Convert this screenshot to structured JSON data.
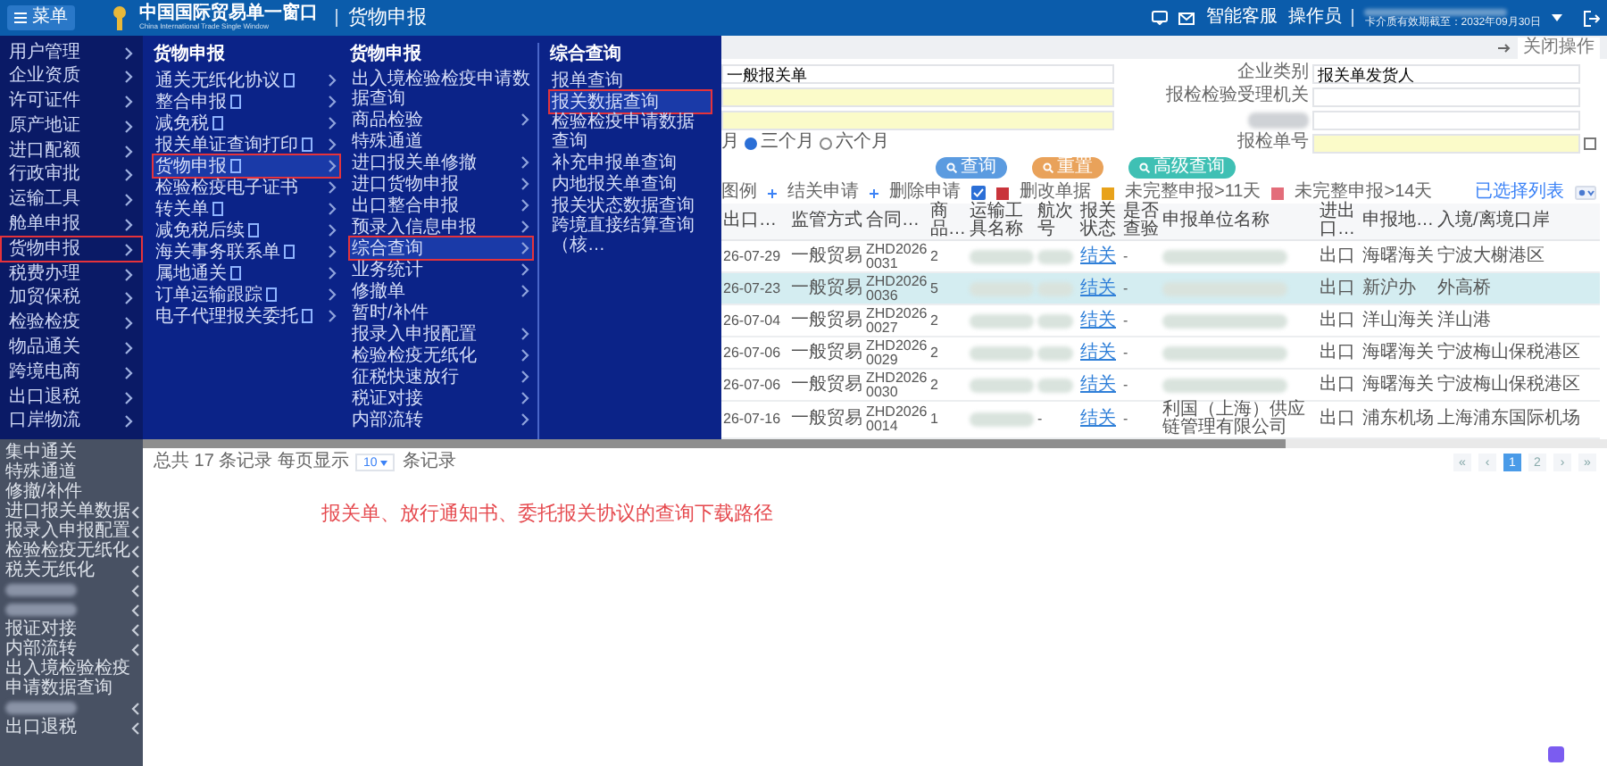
{
  "header": {
    "menu_button": "菜单",
    "logo_title": "中国国际贸易单一窗口",
    "logo_subtitle": "China International Trade Single Window",
    "page_title": "货物申报",
    "service": "智能客服",
    "operator": "操作员",
    "expiry": "卡介质有效期截至：2032年09月30日"
  },
  "sidebar": {
    "items": [
      {
        "label": "用户管理",
        "selected": false
      },
      {
        "label": "企业资质",
        "selected": false
      },
      {
        "label": "许可证件",
        "selected": false
      },
      {
        "label": "原产地证",
        "selected": false
      },
      {
        "label": "进口配额",
        "selected": false
      },
      {
        "label": "行政审批",
        "selected": false
      },
      {
        "label": "运输工具",
        "selected": false
      },
      {
        "label": "舱单申报",
        "selected": false
      },
      {
        "label": "货物申报",
        "selected": true
      },
      {
        "label": "税费办理",
        "selected": false
      },
      {
        "label": "加贸保税",
        "selected": false
      },
      {
        "label": "检验检疫",
        "selected": false
      },
      {
        "label": "物品通关",
        "selected": false
      },
      {
        "label": "跨境电商",
        "selected": false
      },
      {
        "label": "出口退税",
        "selected": false
      },
      {
        "label": "口岸物流",
        "selected": false
      }
    ],
    "sub_items": [
      {
        "kind": "text",
        "label": "集中通关",
        "expandable": false
      },
      {
        "kind": "text",
        "label": "特殊通道",
        "expandable": false
      },
      {
        "kind": "text",
        "label": "修撤/补件",
        "expandable": false
      },
      {
        "kind": "text",
        "label": "进口报关单数据",
        "expandable": true
      },
      {
        "kind": "text",
        "label": "报录入申报配置",
        "expandable": true
      },
      {
        "kind": "text",
        "label": "检验检疫无纸化",
        "expandable": true
      },
      {
        "kind": "text",
        "label": "税关无纸化",
        "expandable": true
      },
      {
        "kind": "redacted",
        "expandable": true
      },
      {
        "kind": "redacted",
        "expandable": true
      },
      {
        "kind": "text",
        "label": "报证对接",
        "expandable": true
      },
      {
        "kind": "text",
        "label": "内部流转",
        "expandable": true
      },
      {
        "kind": "text",
        "label": "出入境检验检疫申请数据查询",
        "expandable": false
      },
      {
        "kind": "redacted",
        "expandable": true
      },
      {
        "kind": "text",
        "label": "出口退税",
        "expandable": true
      }
    ]
  },
  "menu": {
    "columns": [
      {
        "heading": "货物申报",
        "items": [
          {
            "label": "通关无纸化协议",
            "doc": true,
            "arrow": true,
            "selected": false
          },
          {
            "label": "整合申报",
            "doc": true,
            "arrow": true,
            "selected": false
          },
          {
            "label": "减免税",
            "doc": true,
            "arrow": true,
            "selected": false
          },
          {
            "label": "报关单证查询打印",
            "doc": true,
            "arrow": true,
            "selected": false
          },
          {
            "label": "货物申报",
            "doc": true,
            "arrow": true,
            "selected": true
          },
          {
            "label": "检验检疫电子证书",
            "doc": false,
            "arrow": true,
            "selected": false
          },
          {
            "label": "转关单",
            "doc": true,
            "arrow": true,
            "selected": false
          },
          {
            "label": "减免税后续",
            "doc": true,
            "arrow": true,
            "selected": false
          },
          {
            "label": "海关事务联系单",
            "doc": true,
            "arrow": true,
            "selected": false
          },
          {
            "label": "属地通关",
            "doc": true,
            "arrow": true,
            "selected": false
          },
          {
            "label": "订单运输跟踪",
            "doc": true,
            "arrow": true,
            "selected": false
          },
          {
            "label": "电子代理报关委托",
            "doc": true,
            "arrow": true,
            "selected": false
          }
        ]
      },
      {
        "heading": "货物申报",
        "items": [
          {
            "label": "出入境检验检疫申请数据查询",
            "doc": false,
            "arrow": false,
            "selected": false
          },
          {
            "label": "商品检验",
            "doc": false,
            "arrow": true,
            "selected": false
          },
          {
            "label": "特殊通道",
            "doc": false,
            "arrow": false,
            "selected": false
          },
          {
            "label": "进口报关单修撤",
            "doc": false,
            "arrow": true,
            "selected": false
          },
          {
            "label": "进口货物申报",
            "doc": false,
            "arrow": true,
            "selected": false
          },
          {
            "label": "出口整合申报",
            "doc": false,
            "arrow": true,
            "selected": false
          },
          {
            "label": "预录入信息申报",
            "doc": false,
            "arrow": true,
            "selected": false
          },
          {
            "label": "综合查询",
            "doc": false,
            "arrow": true,
            "selected": true
          },
          {
            "label": "业务统计",
            "doc": false,
            "arrow": true,
            "selected": false
          },
          {
            "label": "修撤单",
            "doc": false,
            "arrow": true,
            "selected": false
          },
          {
            "label": "暂时/补件",
            "doc": false,
            "arrow": false,
            "selected": false
          },
          {
            "label": "报录入申报配置",
            "doc": false,
            "arrow": true,
            "selected": false
          },
          {
            "label": "检验检疫无纸化",
            "doc": false,
            "arrow": true,
            "selected": false
          },
          {
            "label": "征税快速放行",
            "doc": false,
            "arrow": true,
            "selected": false
          },
          {
            "label": "税证对接",
            "doc": false,
            "arrow": true,
            "selected": false
          },
          {
            "label": "内部流转",
            "doc": false,
            "arrow": true,
            "selected": false
          }
        ]
      },
      {
        "heading": "综合查询",
        "items": [
          {
            "label": "报单查询",
            "doc": false,
            "arrow": false,
            "selected": false
          },
          {
            "label": "报关数据查询",
            "doc": false,
            "arrow": false,
            "selected": true
          },
          {
            "label": "检验检疫申请数据查询",
            "doc": false,
            "arrow": false,
            "selected": false
          },
          {
            "label": "补充申报单查询",
            "doc": false,
            "arrow": false,
            "selected": false
          },
          {
            "label": "内地报关单查询",
            "doc": false,
            "arrow": false,
            "selected": false
          },
          {
            "label": "报关状态数据查询",
            "doc": false,
            "arrow": false,
            "selected": false
          },
          {
            "label": "跨境直接结算查询（核…",
            "doc": false,
            "arrow": false,
            "selected": false
          }
        ]
      }
    ]
  },
  "tabs": {
    "close_label": "关闭操作"
  },
  "form": {
    "left": [
      {
        "value": "一般报关单",
        "highlight": false
      },
      {
        "highlight": true
      },
      {
        "highlight": true
      }
    ],
    "cut_text": "月",
    "radios": [
      {
        "label": "三个月",
        "selected": true
      },
      {
        "label": "六个月",
        "selected": false
      }
    ],
    "right": [
      {
        "kind": "field",
        "label": "企业类别",
        "value": "报关单发货人",
        "highlight": false
      },
      {
        "kind": "field",
        "label": "报检检验受理机关",
        "highlight": false
      },
      {
        "kind": "redacted",
        "highlight": false
      },
      {
        "kind": "field",
        "label": "报检单号",
        "highlight": true,
        "checked": false
      }
    ]
  },
  "buttons": [
    {
      "label": "查询",
      "color": "#5b9be0"
    },
    {
      "label": "重置",
      "color": "#e9a25a"
    },
    {
      "label": "高级查询",
      "color": "#3fc0b4"
    }
  ],
  "legend": {
    "title": "图例",
    "items": [
      {
        "kind": "plus",
        "label": "结关申请"
      },
      {
        "kind": "plus",
        "label": "删除申请"
      },
      {
        "kind": "check"
      },
      {
        "kind": "swatch",
        "label": "删改单据",
        "color": "#c9343b"
      },
      {
        "kind": "swatch",
        "label": "未完整申报>11天",
        "color": "#e8a21a"
      },
      {
        "kind": "swatch",
        "label": "未完整申报>14天",
        "color": "#e36d7a"
      }
    ],
    "selected_list": "已选择列表"
  },
  "table": {
    "columns": [
      "出口…",
      "监管方式",
      "合同…",
      "商品…",
      "运输工具名称",
      "航次号",
      "报关状态",
      "是否查验",
      "申报单位名称",
      "进出口…",
      "申报地…",
      "入境/离境口岸"
    ],
    "rows": [
      {
        "date": "26-07-29",
        "mode": "一般贸易",
        "contract": "ZHD2026 0031",
        "goods": "2",
        "status": "结关",
        "inspect": "-",
        "direction": "出口",
        "office": "海曙海关",
        "port": "宁波大榭港区",
        "selected": false
      },
      {
        "date": "26-07-23",
        "mode": "一般贸易",
        "contract": "ZHD2026 0036",
        "goods": "5",
        "status": "结关",
        "inspect": "-",
        "direction": "出口",
        "office": "新沪办",
        "port": "外高桥",
        "selected": true
      },
      {
        "date": "26-07-04",
        "mode": "一般贸易",
        "contract": "ZHD2026 0027",
        "goods": "2",
        "status": "结关",
        "inspect": "-",
        "direction": "出口",
        "office": "洋山海关",
        "port": "洋山港",
        "selected": false
      },
      {
        "date": "26-07-06",
        "mode": "一般贸易",
        "contract": "ZHD2026 0029",
        "goods": "2",
        "status": "结关",
        "inspect": "-",
        "direction": "出口",
        "office": "海曙海关",
        "port": "宁波梅山保税港区",
        "selected": false
      },
      {
        "date": "26-07-06",
        "mode": "一般贸易",
        "contract": "ZHD2026 0030",
        "goods": "2",
        "status": "结关",
        "inspect": "-",
        "direction": "出口",
        "office": "海曙海关",
        "port": "宁波梅山保税港区",
        "selected": false
      },
      {
        "date": "26-07-16",
        "mode": "一般贸易",
        "contract": "ZHD2026 0014",
        "goods": "1",
        "voyage": "-",
        "status": "结关",
        "inspect": "-",
        "declarant": "利国（上海）供应链管理有限公司",
        "direction": "出口",
        "office": "浦东机场",
        "port": "上海浦东国际机场",
        "selected": false
      }
    ]
  },
  "footer": {
    "total_prefix": "总共",
    "total": "17",
    "total_mid": "条记录 每页显示",
    "page_size": "10",
    "total_suffix": "条记录",
    "pages": [
      {
        "label": "«",
        "kind": "nav"
      },
      {
        "label": "‹",
        "kind": "nav"
      },
      {
        "label": "1",
        "kind": "page",
        "selected": true
      },
      {
        "label": "2",
        "kind": "page",
        "selected": false
      },
      {
        "label": "›",
        "kind": "nav"
      },
      {
        "label": "»",
        "kind": "nav"
      }
    ]
  },
  "caption": "报关单、放行通知书、委托报关协议的查询下载路径"
}
